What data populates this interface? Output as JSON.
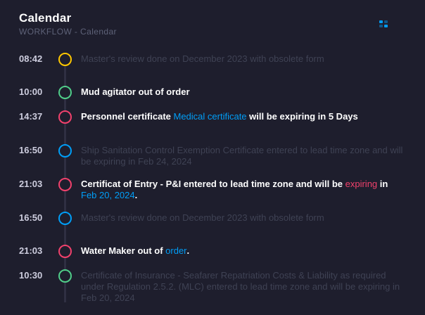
{
  "header": {
    "title": "Calendar",
    "subtitle": "WORKFLOW - Calendar",
    "menu_icon": "grid-dots-icon"
  },
  "colors": {
    "yellow": "#ffc700",
    "green": "#50cd89",
    "red": "#f1416c",
    "blue": "#009ef7",
    "muted_text": "#3f4254",
    "bold_text": "#ffffff"
  },
  "timeline": [
    {
      "time": "08:42",
      "dot_color": "#ffc700",
      "style": "muted",
      "text_1": "Master's review done on December 2023 with obsolete form"
    },
    {
      "time": "10:00",
      "dot_color": "#50cd89",
      "style": "bold",
      "text_1": "Mud agitator out of order"
    },
    {
      "time": "14:37",
      "dot_color": "#f1416c",
      "style": "bold",
      "text_1": "Personnel certificate ",
      "link_1": "Medical certificate",
      "text_2": " will be expiring in 5 Days"
    },
    {
      "time": "16:50",
      "dot_color": "#009ef7",
      "style": "muted",
      "text_1": "Ship Sanitation Control Exemption Certificate entered to lead time zone and will be expiring in Feb 24, 2024"
    },
    {
      "time": "21:03",
      "dot_color": "#f1416c",
      "style": "bold",
      "text_1": "Certificat of Entry - P&I entered to lead time zone and will be ",
      "highlight_red": "expiring",
      "text_2": " in ",
      "link_1": "Feb 20, 2024",
      "text_3": "."
    },
    {
      "time": "16:50",
      "dot_color": "#009ef7",
      "style": "muted",
      "text_1": "Master's review done on December 2023 with obsolete form"
    },
    {
      "time": "21:03",
      "dot_color": "#f1416c",
      "style": "bold",
      "text_1": "Water Maker out of ",
      "link_1": "order",
      "text_2": "."
    },
    {
      "time": "10:30",
      "dot_color": "#50cd89",
      "style": "muted",
      "text_1": "Certificate of Insurance - Seafarer Repatriation Costs & Liability as required under Regulation 2.5.2. (MLC) entered to lead time zone and will be expiring in Feb 20, 2024"
    }
  ]
}
